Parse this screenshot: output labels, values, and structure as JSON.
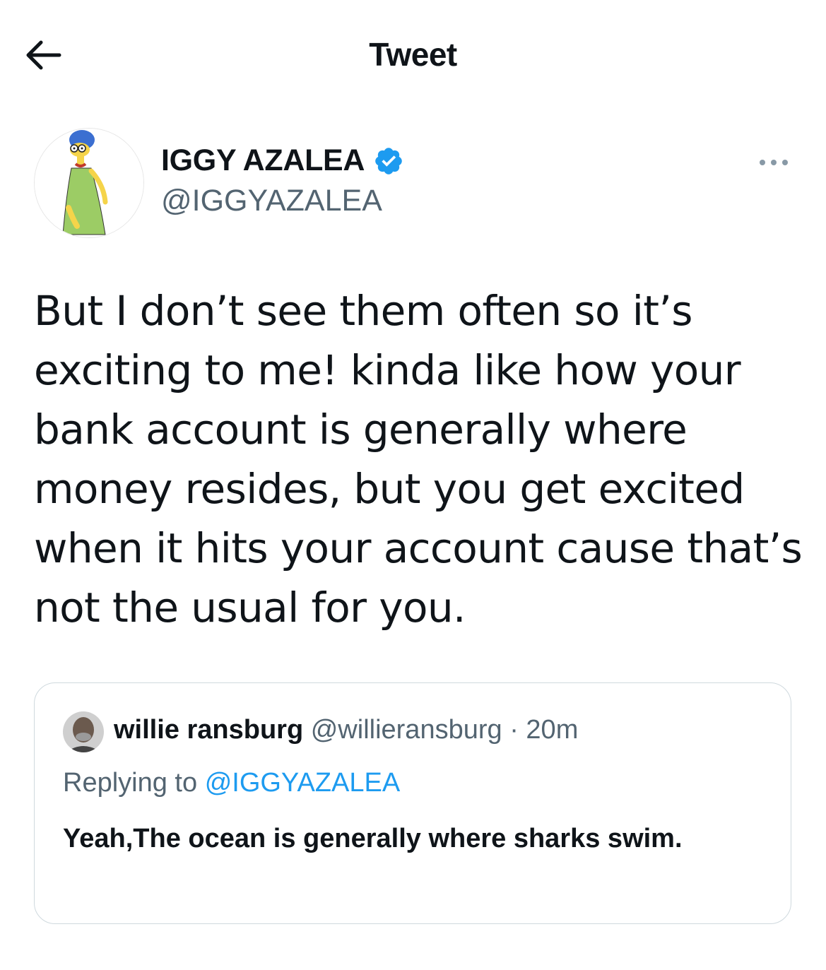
{
  "header": {
    "title": "Tweet",
    "back_icon": "arrow-left-icon"
  },
  "author": {
    "display_name": "IGGY AZALEA",
    "handle": "@IGGYAZALEA",
    "verified": true,
    "avatar": "cartoon-avatar",
    "more_icon": "more-horizontal-icon"
  },
  "tweet": {
    "text": "But I don’t see them often so it’s exciting to me! kinda like how your bank account is generally where money resides, but you get excited when it hits your account cause that’s not the usual for you."
  },
  "quoted_tweet": {
    "display_name": "willie ransburg",
    "handle": "@willieransburg",
    "separator": "·",
    "time": "20m",
    "replying_prefix": "Replying to",
    "replying_to": "@IGGYAZALEA",
    "text": "Yeah,The ocean is generally where sharks swim."
  },
  "colors": {
    "text_primary": "#0f1419",
    "text_secondary": "#536471",
    "accent": "#1d9bf0",
    "border": "#cfd9de"
  }
}
